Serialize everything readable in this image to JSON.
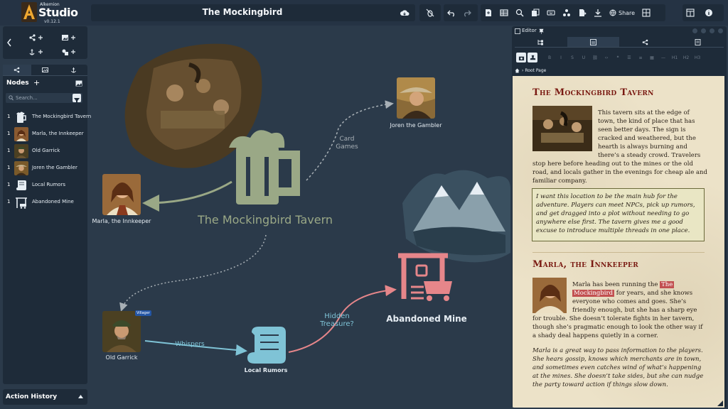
{
  "app": {
    "brand_top": "Alkemion",
    "brand": "Studio",
    "version": "v0.12.1",
    "accent": "#f0a830"
  },
  "document": {
    "title": "The Mockingbird",
    "cloud_icon": "cloud-sync-icon"
  },
  "toolbar": {
    "share_label": "Share"
  },
  "sidebar": {
    "tabs": [
      "graph-icon",
      "image-icon",
      "anchor-icon"
    ],
    "nodes_title": "Nodes",
    "add_label": "+",
    "search_placeholder": "Search...",
    "nodes": [
      {
        "count": "1",
        "label": "The Mockingbird Tavern"
      },
      {
        "count": "1",
        "label": "Marla, the Innkeeper"
      },
      {
        "count": "1",
        "label": "Old Garrick"
      },
      {
        "count": "1",
        "label": "Joren the Gambler"
      },
      {
        "count": "1",
        "label": "Local Rumors"
      },
      {
        "count": "1",
        "label": "Abandoned Mine"
      }
    ],
    "history_title": "Action History"
  },
  "graph": {
    "tavern_label": "The Mockingbird Tavern",
    "marla_label": "Marla, the Innkeeper",
    "joren_label": "Joren the Gambler",
    "garrick_label": "Old Garrick",
    "garrick_badge": "Villager",
    "rumors_label": "Local Rumors",
    "mine_label": "Abandoned Mine",
    "edge_card_1": "Card",
    "edge_card_2": "Games",
    "edge_whispers": "Whispers",
    "edge_hidden_1": "Hidden",
    "edge_hidden_2": "Treasure?",
    "colors": {
      "tavern": "#9aa886",
      "scroll": "#7fc3d6",
      "mine": "#e6868a",
      "link_pink": "#e6868a"
    }
  },
  "editor": {
    "title": "Editor",
    "breadcrumb": "Root Page",
    "format_buttons": [
      "B",
      "I",
      "S",
      "U",
      "H1",
      "H2",
      "H3"
    ],
    "sections": [
      {
        "heading": "The Mockingbird Tavern",
        "body_lines": [
          "This tavern sits at the edge of",
          "town, the kind of place that has",
          "seen better days. The sign is",
          "cracked and weathered, but the",
          "hearth is always burning and",
          "there’s a steady crowd. Travelers",
          "stop here before heading out to the mines or the old",
          "road, and locals gather in the evenings for cheap ale and",
          "familiar company."
        ],
        "note_lines": [
          "I want this location to be the main hub for the",
          "adventure. Players can meet NPCs, pick up rumors,",
          "and get dragged into a plot without needing to go",
          "anywhere else first. The tavern gives me a good",
          "excuse to introduce multiple threads in one place."
        ]
      },
      {
        "heading": "Marla, the Innkeeper",
        "line1_pre": "Marla has been running the ",
        "line1_hl": "The",
        "line2_hl": "Mockingbird",
        "line2_post": " for years, and she knows",
        "body_lines": [
          "everyone who comes and goes. She’s",
          "friendly enough, but she has a sharp eye",
          "for trouble. She doesn’t tolerate fights in her tavern,",
          "though she’s pragmatic enough to look the other way if",
          "a shady deal happens quietly in a corner."
        ],
        "italic_lines": [
          "Marla is a great way to pass information to the players.",
          "She hears gossip, knows which merchants are in town,",
          "and sometimes even catches wind of what’s happening",
          "at the mines. She doesn’t take sides, but she can nudge",
          "the party toward action if things slow down."
        ]
      }
    ]
  }
}
